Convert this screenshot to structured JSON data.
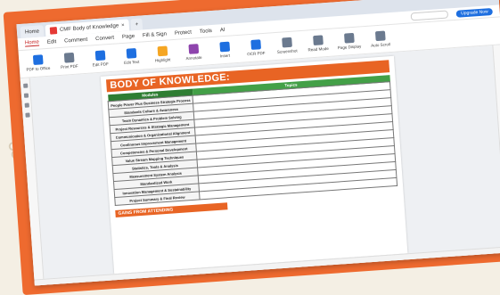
{
  "browser": {
    "tabs": [
      {
        "label": "Home",
        "active": false
      },
      {
        "label": "CMF Body of Knowledge",
        "active": true
      }
    ],
    "new_tab": "+"
  },
  "menu": {
    "items": [
      "Home",
      "Edit",
      "Comment",
      "Convert",
      "Page",
      "Fill & Sign",
      "Protect",
      "Tools",
      "AI"
    ],
    "selected": "Home",
    "upgrade": "Upgrade Now"
  },
  "toolbar": {
    "tools": [
      {
        "label": "PDF to Office",
        "icon": "pdf-to-office-icon",
        "color": "#1e6fe0"
      },
      {
        "label": "Print PDF",
        "icon": "print-icon",
        "color": "#6b7a8f"
      },
      {
        "label": "Edit PDF",
        "icon": "edit-icon",
        "color": "#1e6fe0"
      },
      {
        "label": "Edit Text",
        "icon": "edit-text-icon",
        "color": "#1e6fe0"
      },
      {
        "label": "Highlight",
        "icon": "highlight-icon",
        "color": "#f5a623"
      },
      {
        "label": "Annotate",
        "icon": "annotate-icon",
        "color": "#8e44ad"
      },
      {
        "label": "Insert",
        "icon": "insert-icon",
        "color": "#1e6fe0"
      },
      {
        "label": "OCR PDF",
        "icon": "ocr-icon",
        "color": "#1e6fe0"
      },
      {
        "label": "Screenshot",
        "icon": "screenshot-icon",
        "color": "#6b7a8f"
      },
      {
        "label": "Read Mode",
        "icon": "read-mode-icon",
        "color": "#6b7a8f"
      },
      {
        "label": "Page Display",
        "icon": "page-display-icon",
        "color": "#6b7a8f"
      },
      {
        "label": "Auto Scroll",
        "icon": "scroll-icon",
        "color": "#6b7a8f"
      }
    ]
  },
  "document": {
    "title": "BODY OF KNOWLEDGE:",
    "table_headers": [
      "Modules",
      "Topics"
    ],
    "rows": [
      {
        "module": "People Power Plus Business Strategic Process",
        "topic": ""
      },
      {
        "module": "Standards Culture & Awareness",
        "topic": ""
      },
      {
        "module": "Team Dynamics & Problem Solving",
        "topic": ""
      },
      {
        "module": "Project Resources & Strategic Management",
        "topic": ""
      },
      {
        "module": "Communication & Organizational Alignment",
        "topic": ""
      },
      {
        "module": "Continuous Improvement Management",
        "topic": ""
      },
      {
        "module": "Competencies & Personal Development",
        "topic": ""
      },
      {
        "module": "Value Stream Mapping Techniques",
        "topic": ""
      },
      {
        "module": "Statistics, Tools & Analysis",
        "topic": ""
      },
      {
        "module": "Measurement System Analysis",
        "topic": ""
      },
      {
        "module": "Standardized Work",
        "topic": ""
      },
      {
        "module": "Innovation Management & Sustainability",
        "topic": ""
      },
      {
        "module": "Project Summary & Final Review",
        "topic": ""
      }
    ],
    "section2_title": "GAINS FROM ATTENDING",
    "paragraph": ""
  },
  "status": {
    "page": "",
    "zoom": ""
  }
}
